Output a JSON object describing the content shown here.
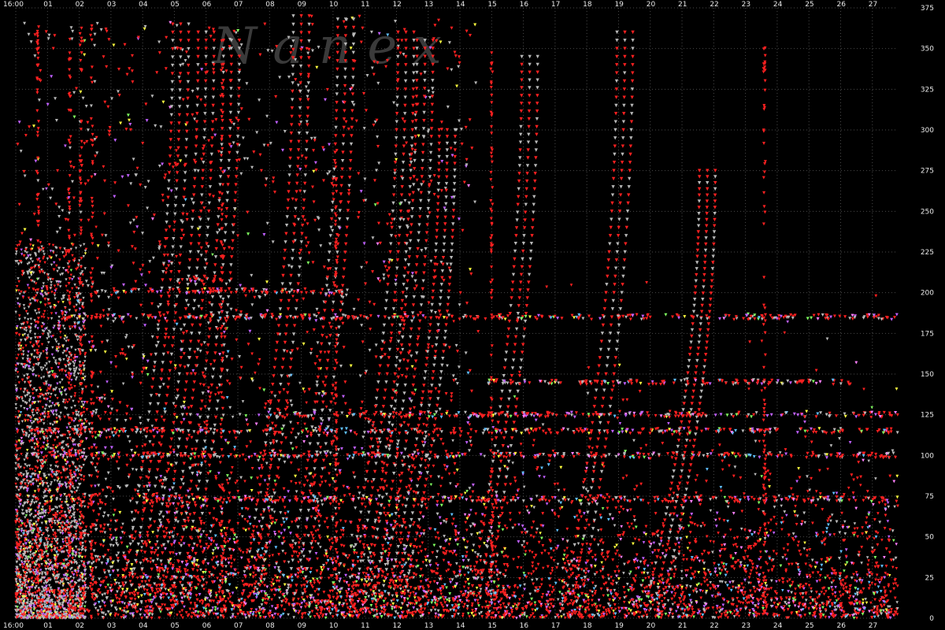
{
  "chart_data": {
    "type": "scatter",
    "title": "",
    "xlabel": "",
    "ylabel": "",
    "watermark": "N a n e x",
    "x_ticks": [
      "16:00",
      "01",
      "02",
      "03",
      "04",
      "05",
      "06",
      "07",
      "08",
      "09",
      "10",
      "11",
      "12",
      "13",
      "14",
      "15",
      "16",
      "17",
      "18",
      "19",
      "20",
      "21",
      "22",
      "23",
      "24",
      "25",
      "26",
      "27"
    ],
    "y_ticks": [
      0,
      25,
      50,
      75,
      100,
      125,
      150,
      175,
      200,
      225,
      250,
      275,
      300,
      325,
      350,
      375
    ],
    "xlim": [
      0,
      27.8
    ],
    "ylim": [
      0,
      375
    ],
    "grid": true,
    "legend": "none",
    "colors": {
      "background": "#000000",
      "grid": "#4a4a4a",
      "text": "#e8e8e8",
      "series": [
        "#ff2020",
        "#b8b8b8",
        "#c060ff",
        "#ffff40",
        "#60c0ff",
        "#ff80ff",
        "#80ff60"
      ]
    },
    "series": [
      {
        "marker": "triangle-down",
        "color": "#ff2020"
      },
      {
        "marker": "triangle-down",
        "color": "#b8b8b8"
      },
      {
        "marker": "triangle-down",
        "color": "#c060ff"
      },
      {
        "marker": "triangle-down",
        "color": "#ffff40"
      }
    ],
    "curves": [
      {
        "x_end": 5.2,
        "y_end": 365
      },
      {
        "x_end": 6.0,
        "y_end": 360
      },
      {
        "x_end": 6.8,
        "y_end": 355
      },
      {
        "x_end": 9.0,
        "y_end": 370
      },
      {
        "x_end": 10.4,
        "y_end": 368
      },
      {
        "x_end": 12.3,
        "y_end": 360
      },
      {
        "x_end": 12.9,
        "y_end": 355
      },
      {
        "x_end": 13.6,
        "y_end": 300
      },
      {
        "x_end": 16.2,
        "y_end": 345
      },
      {
        "x_end": 19.2,
        "y_end": 360
      },
      {
        "x_end": 21.8,
        "y_end": 275
      }
    ],
    "hlines": [
      {
        "y": 201,
        "x1": 2.5,
        "x2": 10.5
      },
      {
        "y": 185,
        "x1": 1.5,
        "x2": 27.8
      },
      {
        "y": 145,
        "x1": 14.8,
        "x2": 26.5
      },
      {
        "y": 100,
        "x1": 0.5,
        "x2": 27.8
      },
      {
        "y": 115,
        "x1": 0.5,
        "x2": 27.8
      },
      {
        "y": 73,
        "x1": 4.0,
        "x2": 27.8
      },
      {
        "y": 208,
        "x1": 5.0,
        "x2": 6.9
      },
      {
        "y": 125,
        "x1": 8.0,
        "x2": 27.8
      }
    ],
    "vlines": [
      {
        "x": 2.05,
        "y2": 370
      },
      {
        "x": 2.4,
        "y2": 368
      },
      {
        "x": 1.7,
        "y2": 355
      },
      {
        "x": 6.5,
        "y2": 368
      },
      {
        "x": 10.1,
        "y2": 290
      },
      {
        "x": 15.0,
        "y2": 360
      },
      {
        "x": 23.6,
        "y2": 360
      },
      {
        "x": 0.7,
        "y2": 365
      }
    ]
  }
}
